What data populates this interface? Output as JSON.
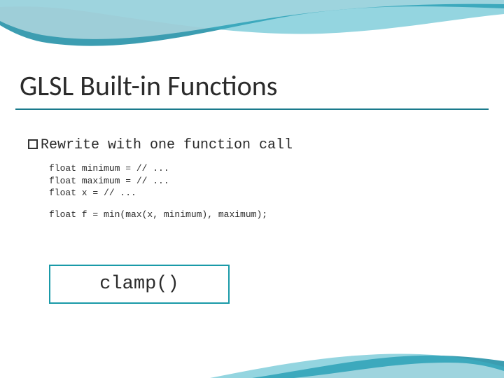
{
  "title": "GLSL Built-in Functions",
  "subtitle": "Rewrite with one function call",
  "code": {
    "l1": "float minimum = // ...",
    "l2": "float maximum = // ...",
    "l3": "float x = // ...",
    "l4": "float f = min(max(x, minimum), maximum);"
  },
  "answer": "clamp()"
}
